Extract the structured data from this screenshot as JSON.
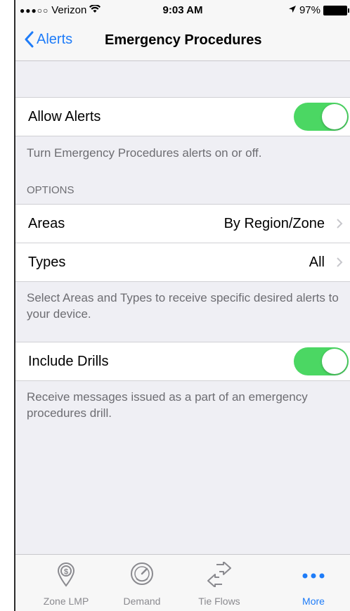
{
  "status_bar": {
    "signal": "●●●○○",
    "carrier": "Verizon",
    "time": "9:03 AM",
    "battery": "97%"
  },
  "nav": {
    "back_label": "Alerts",
    "title": "Emergency Procedures"
  },
  "alerts": {
    "label": "Allow Alerts",
    "enabled": true,
    "footnote": "Turn Emergency Procedures alerts on or off."
  },
  "options": {
    "header": "OPTIONS",
    "rows": [
      {
        "label": "Areas",
        "value": "By Region/Zone"
      },
      {
        "label": "Types",
        "value": "All"
      }
    ],
    "footnote": "Select Areas and Types to receive specific desired alerts to your device."
  },
  "drills": {
    "label": "Include Drills",
    "enabled": true,
    "footnote": "Receive messages issued as a part of an emergency procedures drill."
  },
  "tabs": [
    {
      "label": "Zone LMP",
      "icon": "dollar-pin-icon"
    },
    {
      "label": "Demand",
      "icon": "gauge-icon"
    },
    {
      "label": "Tie Flows",
      "icon": "arrows-icon"
    },
    {
      "label": "More",
      "icon": "more-dots-icon",
      "active": true
    }
  ],
  "colors": {
    "accent": "#1e7cf8",
    "toggle_on": "#4bd763",
    "background": "#efeff4"
  }
}
